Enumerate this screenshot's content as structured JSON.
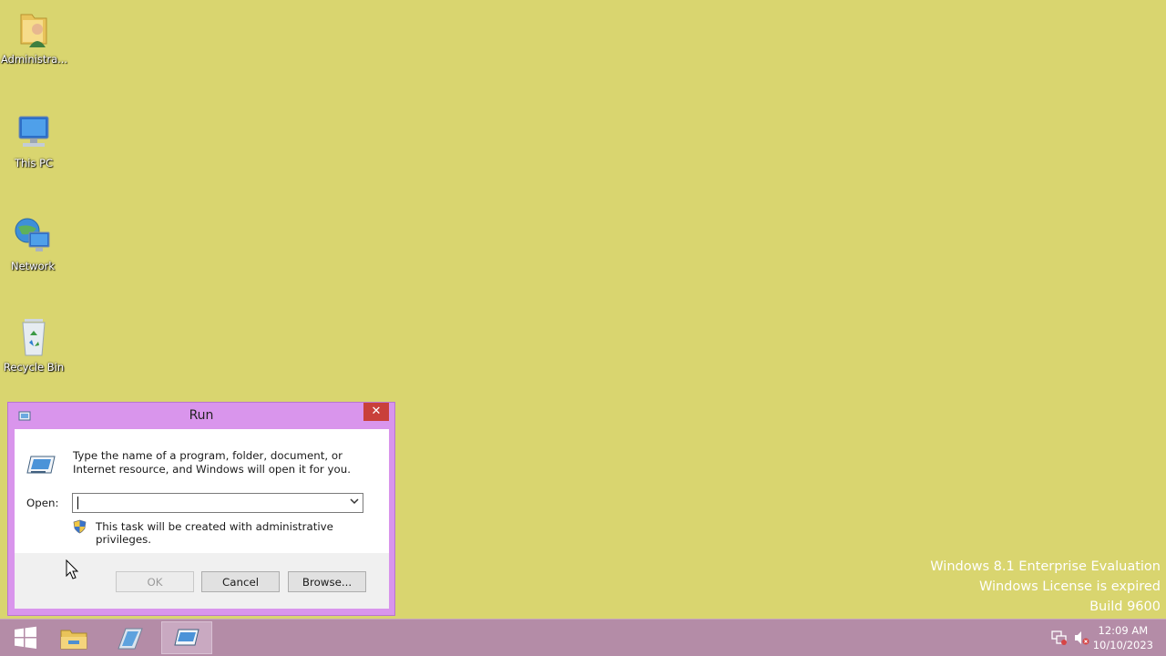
{
  "desktop": {
    "icons": [
      {
        "label": "Administra...",
        "icon": "user-folder-icon"
      },
      {
        "label": "This PC",
        "icon": "computer-icon"
      },
      {
        "label": "Network",
        "icon": "network-icon"
      },
      {
        "label": "Recycle Bin",
        "icon": "recycle-bin-icon"
      }
    ],
    "watermark": [
      "Windows 8.1 Enterprise Evaluation",
      "Windows License is expired",
      "Build 9600"
    ],
    "background_color": "#d9d56f"
  },
  "run_dialog": {
    "title": "Run",
    "close_glyph": "✕",
    "description": "Type the name of a program, folder, document, or Internet resource, and Windows will open it for you.",
    "open_label": "Open:",
    "open_value": "",
    "admin_note": "This task will be created with administrative privileges.",
    "buttons": {
      "ok": "OK",
      "cancel": "Cancel",
      "browse": "Browse..."
    },
    "accent_color": "#d995ec"
  },
  "taskbar": {
    "apps": [
      {
        "name": "Start",
        "icon": "windows-logo-icon"
      },
      {
        "name": "File Explorer",
        "icon": "file-explorer-icon"
      },
      {
        "name": "Server Manager",
        "icon": "server-manager-icon"
      },
      {
        "name": "Run",
        "icon": "run-icon",
        "active": true
      }
    ],
    "clock": {
      "time": "12:09 AM",
      "date": "10/10/2023"
    },
    "background_color": "#b48ca7"
  }
}
